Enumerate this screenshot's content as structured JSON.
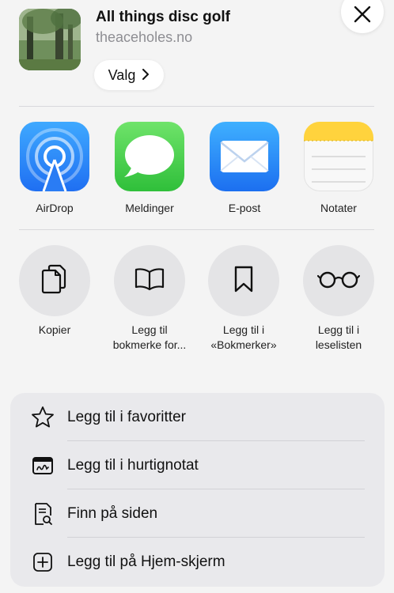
{
  "header": {
    "title": "All things disc golf",
    "url": "theaceholes.no",
    "options_label": "Valg"
  },
  "apps": [
    {
      "label": "AirDrop",
      "icon": "airdrop-icon"
    },
    {
      "label": "Meldinger",
      "icon": "messages-icon"
    },
    {
      "label": "E-post",
      "icon": "mail-icon"
    },
    {
      "label": "Notater",
      "icon": "notes-icon"
    }
  ],
  "actions": [
    {
      "label": "Kopier",
      "icon": "copy-icon"
    },
    {
      "label": "Legg til bokmerke for...",
      "icon": "book-icon"
    },
    {
      "label": "Legg til i «Bokmerker»",
      "icon": "bookmark-icon"
    },
    {
      "label": "Legg til i leselisten",
      "icon": "glasses-icon"
    }
  ],
  "list": [
    {
      "label": "Legg til i favoritter",
      "icon": "star-icon"
    },
    {
      "label": "Legg til i hurtignotat",
      "icon": "quick-note-icon"
    },
    {
      "label": "Finn på siden",
      "icon": "find-on-page-icon"
    },
    {
      "label": "Legg til på Hjem-skjerm",
      "icon": "add-square-icon"
    }
  ],
  "colors": {
    "background": "#f4f4f4",
    "card": "#e9e9ec",
    "action_circle": "#e4e4e6",
    "secondary_text": "#8e8e93"
  }
}
